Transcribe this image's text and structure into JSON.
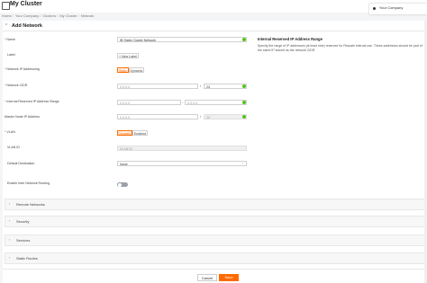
{
  "app": {
    "title": "My Cluster",
    "company": "Your Company"
  },
  "breadcrumb": [
    "Home",
    "Your Company",
    "Clusters",
    "My Cluster",
    "Network"
  ],
  "panel": {
    "title": "Add Network"
  },
  "form": {
    "name": {
      "label": "Name",
      "value": "IB Static Cluster Network"
    },
    "label": {
      "label": "Label",
      "button": "+ New Label"
    },
    "ip_addressing": {
      "label": "Network IP Addressing",
      "options": [
        "Static",
        "Dynamic"
      ],
      "selected": "Static"
    },
    "cidr": {
      "label": "Network CIDR",
      "ip_placeholder": "0.0.0.0",
      "separator": "/",
      "prefix_value": "24"
    },
    "reserved_range": {
      "label": "Internal Reserved IP Address Range",
      "start_placeholder": "0.0.0.0",
      "separator": "-",
      "end_placeholder": "0.0.0.0"
    },
    "master_ip": {
      "label": "Master Node IP Address",
      "ip_placeholder": "0.0.0.0",
      "separator": "/",
      "prefix_placeholder": "24"
    },
    "vlan": {
      "label": "VLAN",
      "options": [
        "Disabled",
        "Enabled"
      ],
      "selected": "Disabled"
    },
    "vlan_id": {
      "label": "VLAN ID",
      "placeholder": "VLAN ID"
    },
    "default_destination": {
      "label": "Default Destination",
      "value": "None"
    },
    "inter_network_routing": {
      "label": "Enable Inter Network Routing",
      "enabled": false
    }
  },
  "help": {
    "title": "Internal Reserved IP Address Range",
    "text": "Specify the range of IP addresses (at least nine) reserved for Rescale internal use. These addresses should be part of the same IP subnet as the network CIDR."
  },
  "sections": [
    "Remote Networks",
    "Security",
    "Services",
    "Static Routes"
  ],
  "actions": {
    "cancel": "Cancel",
    "save": "Save"
  },
  "colors": {
    "accent": "#ff6a00",
    "valid": "#52c41a"
  }
}
